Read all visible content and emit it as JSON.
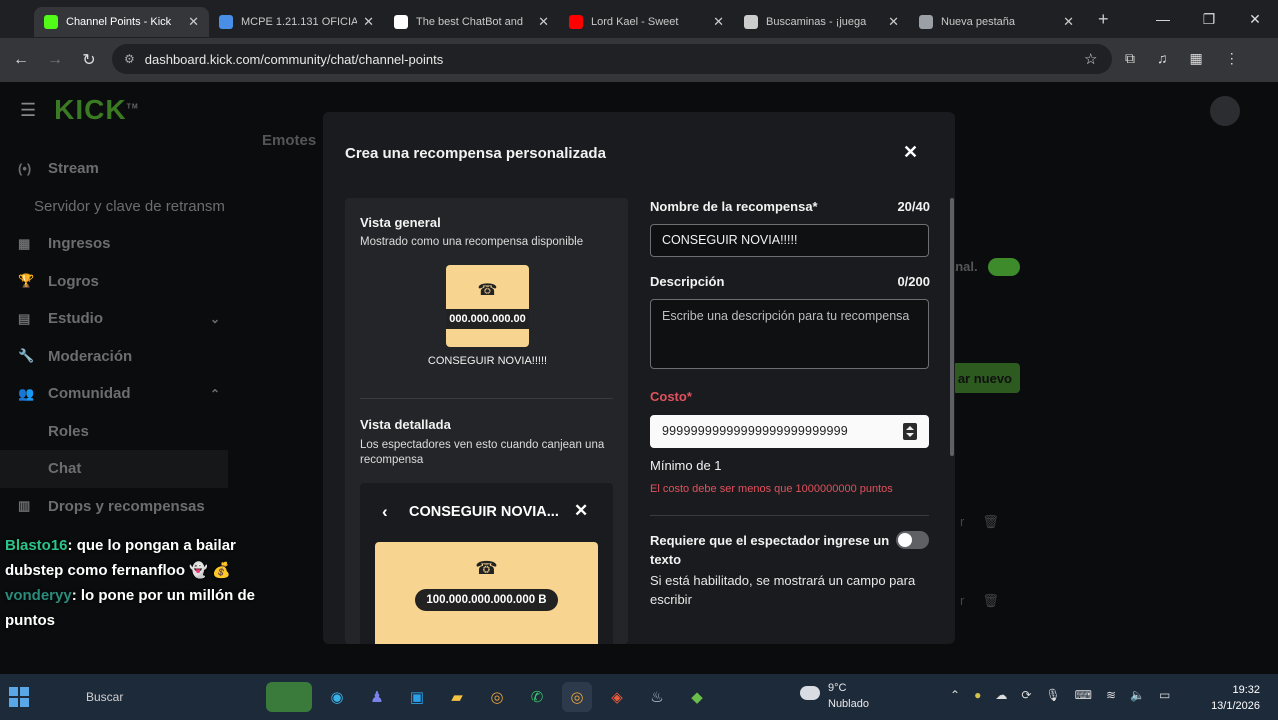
{
  "browser": {
    "tabs": [
      {
        "label": "Channel Points - Kick",
        "active": true,
        "favicon_color": "#53fc18"
      },
      {
        "label": "MCPE 1.21.131 OFICIAL",
        "active": false,
        "favicon_color": "#4a8fe7"
      },
      {
        "label": "The best ChatBot and",
        "active": false,
        "favicon_color": "#ffffff"
      },
      {
        "label": "Lord Kael - Sweet",
        "active": false,
        "favicon_color": "#ff0000"
      },
      {
        "label": "Buscaminas - ¡juega",
        "active": false,
        "favicon_color": "#cccccc"
      },
      {
        "label": "Nueva pestaña",
        "active": false,
        "favicon_color": "#9aa0a6"
      }
    ],
    "url": "dashboard.kick.com/community/chat/channel-points"
  },
  "app": {
    "logo": "KICK",
    "logo_tm": "TM",
    "page_heading": "Emotes",
    "sidebar": [
      {
        "label": "Stream",
        "icon": "broadcast-icon",
        "glyph": "(•)",
        "type": "main"
      },
      {
        "label": "Servidor y clave de retransm",
        "type": "plain"
      },
      {
        "label": "Ingresos",
        "icon": "revenue-icon",
        "glyph": "▦",
        "type": "main"
      },
      {
        "label": "Logros",
        "icon": "trophy-icon",
        "glyph": "🏆",
        "type": "main"
      },
      {
        "label": "Estudio",
        "icon": "studio-icon",
        "glyph": "▤",
        "type": "main",
        "chevron": "⌄"
      },
      {
        "label": "Moderación",
        "icon": "wrench-icon",
        "glyph": "🔧",
        "type": "main"
      },
      {
        "label": "Comunidad",
        "icon": "community-icon",
        "glyph": "👥",
        "type": "main",
        "chevron": "⌃"
      },
      {
        "label": "Roles",
        "type": "sub"
      },
      {
        "label": "Chat",
        "type": "sub",
        "active": true
      },
      {
        "label": "Drops y recompensas",
        "icon": "drops-icon",
        "glyph": "▥",
        "type": "main"
      }
    ],
    "bg_toggle_text": "anal.",
    "bg_button_text": "ar nuevo"
  },
  "chat_overlay": {
    "messages": [
      {
        "user": "Blasto16",
        "text": ": que lo pongan a bailar dubstep como fernanfloo 👻 💰"
      },
      {
        "user": "vonderyy",
        "text": ": lo pone por un millón de puntos"
      }
    ]
  },
  "modal": {
    "title": "Crea una recompensa personalizada",
    "preview": {
      "general_title": "Vista general",
      "general_subtitle": "Mostrado como una recompensa disponible",
      "card_cost": "000.000.000.00",
      "card_label": "CONSEGUIR NOVIA!!!!!",
      "detail_title": "Vista detallada",
      "detail_subtitle": "Los espectadores ven esto cuando canjean una recompensa",
      "detail_card_title": "CONSEGUIR NOVIA...",
      "detail_cost": "100.000.000.000.000 B",
      "card_color": "#f7d48f"
    },
    "form": {
      "name_label": "Nombre de la recompensa*",
      "name_counter": "20/40",
      "name_value": "CONSEGUIR NOVIA!!!!!",
      "desc_label": "Descripción",
      "desc_counter": "0/200",
      "desc_placeholder": "Escribe una descripción para tu recompensa",
      "cost_label": "Costo*",
      "cost_value": "99999999999999999999999999",
      "min_note": "Mínimo de 1",
      "cost_error": "El costo debe ser menos que 1000000000 puntos",
      "require_text_label": "Requiere que el espectador ingrese un texto",
      "require_text_enabled": false,
      "require_text_help": "Si está habilitado, se mostrará un campo para escribir"
    },
    "error_color": "#e0525e"
  },
  "taskbar": {
    "search": "Buscar",
    "weather_temp": "9°C",
    "weather_desc": "Nublado",
    "time": "19:32",
    "date": "13/1/2026"
  }
}
